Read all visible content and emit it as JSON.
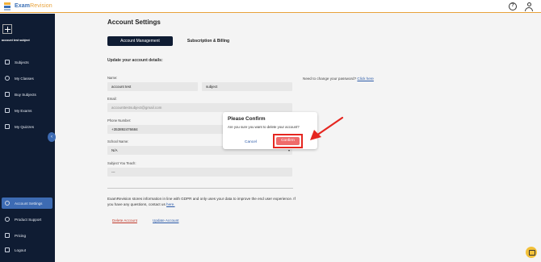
{
  "topbar": {
    "brand_prefix": "Exam",
    "brand_suffix": "Revision",
    "help_icon": "question-circle-icon",
    "user_icon": "user-icon"
  },
  "sidebar": {
    "account_name": "account test subject",
    "items": [
      {
        "label": "Subjects",
        "icon": "book-icon"
      },
      {
        "label": "My Classes",
        "icon": "people-icon"
      },
      {
        "label": "Buy Subjects",
        "icon": "cart-icon"
      },
      {
        "label": "My Exams",
        "icon": "open-book-icon"
      },
      {
        "label": "My Quizzes",
        "icon": "checkbox-icon"
      },
      {
        "label": "Account Settings",
        "icon": "gear-icon"
      },
      {
        "label": "Product Support",
        "icon": "help-icon"
      },
      {
        "label": "Pricing",
        "icon": "card-icon"
      },
      {
        "label": "Logout",
        "icon": "logout-icon"
      }
    ],
    "active_item": "Account Settings",
    "collapse_icon": "‹"
  },
  "main": {
    "title": "Account Settings",
    "tabs": [
      {
        "label": "Account Management",
        "active": true
      },
      {
        "label": "Subscription & Billing",
        "active": false
      }
    ],
    "section_label": "Update your account details:",
    "fields": {
      "name_label": "Name:",
      "first_name": "account test",
      "last_name": "subject",
      "email_label": "Email:",
      "email_value": "accounttestsubject@gmail.com",
      "phone_label": "Phone Number:",
      "phone_value": "+353892476684",
      "school_label": "School Name:",
      "school_value": "N/A",
      "subject_label": "Subject You Teach:",
      "subject_value": "---"
    },
    "password_note": "Need to change your password?",
    "password_link": "Click here",
    "gdpr_text": "ExamRevision stores information in line with GDPR and only uses your data to improve the end user experience. If you have any questions, contact us",
    "gdpr_link": "here.",
    "delete_label": "Delete Account",
    "update_label": "Update Account"
  },
  "modal": {
    "title": "Please Confirm",
    "message": "Are you sure you want to delete your account?",
    "cancel_label": "Cancel",
    "confirm_label": "Confirm"
  },
  "colors": {
    "sidebar_bg": "#0f1c33",
    "active_nav": "#3d6bb3",
    "confirm_button": "#ef6b6b",
    "annotation_red": "#e52620",
    "accent_orange": "#e8a23a"
  }
}
